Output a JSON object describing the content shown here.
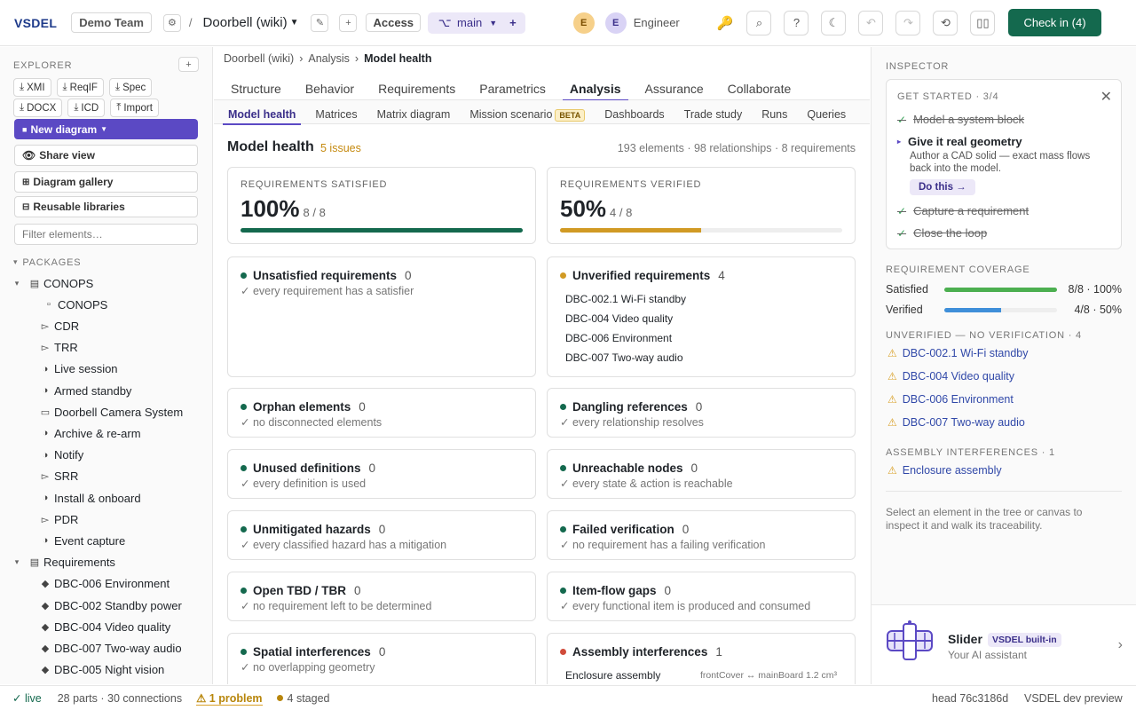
{
  "header": {
    "logo": "VSDEL",
    "team": "Demo Team",
    "sep": "/",
    "project": "Doorbell (wiki)",
    "access": "Access",
    "branch": "main",
    "avatar1": "E",
    "avatar2": "E",
    "user": "Engineer",
    "checkin": "Check in (4)"
  },
  "explorer": {
    "title": "EXPLORER",
    "add": "+",
    "exports": [
      "XMI",
      "ReqIF",
      "Spec",
      "DOCX",
      "ICD",
      "Import"
    ],
    "new_diagram": "New diagram",
    "share_view": "Share view",
    "gallery": "Diagram gallery",
    "libraries": "Reusable libraries",
    "filter_placeholder": "Filter elements…",
    "packages_title": "PACKAGES",
    "tree": [
      {
        "label": "CONOPS",
        "icon": "▤",
        "depth": 0,
        "caret": "▾"
      },
      {
        "label": "CONOPS",
        "icon": "▫",
        "depth": 2
      },
      {
        "label": "CDR",
        "icon": "▻",
        "depth": 1
      },
      {
        "label": "TRR",
        "icon": "▻",
        "depth": 1
      },
      {
        "label": "Live session",
        "icon": "◑",
        "depth": 1
      },
      {
        "label": "Armed standby",
        "icon": "◑",
        "depth": 1
      },
      {
        "label": "Doorbell Camera System",
        "icon": "▭",
        "depth": 1
      },
      {
        "label": "Archive & re-arm",
        "icon": "◑",
        "depth": 1
      },
      {
        "label": "Notify",
        "icon": "◑",
        "depth": 1
      },
      {
        "label": "SRR",
        "icon": "▻",
        "depth": 1
      },
      {
        "label": "Install & onboard",
        "icon": "◑",
        "depth": 1
      },
      {
        "label": "PDR",
        "icon": "▻",
        "depth": 1
      },
      {
        "label": "Event capture",
        "icon": "◑",
        "depth": 1
      },
      {
        "label": "Requirements",
        "icon": "▤",
        "depth": 0,
        "caret": "▾"
      },
      {
        "label": "DBC-006 Environment",
        "icon": "◆",
        "depth": 1
      },
      {
        "label": "DBC-002 Standby power",
        "icon": "◆",
        "depth": 1
      },
      {
        "label": "DBC-004 Video quality",
        "icon": "◆",
        "depth": 1
      },
      {
        "label": "DBC-007 Two-way audio",
        "icon": "◆",
        "depth": 1
      },
      {
        "label": "DBC-005 Night vision",
        "icon": "◆",
        "depth": 1
      }
    ]
  },
  "breadcrumb": [
    "Doorbell (wiki)",
    "Analysis",
    "Model health"
  ],
  "tabs": [
    "Structure",
    "Behavior",
    "Requirements",
    "Parametrics",
    "Analysis",
    "Assurance",
    "Collaborate"
  ],
  "subtabs": [
    "Model health",
    "Matrices",
    "Matrix diagram",
    "Mission scenario",
    "Dashboards",
    "Trade study",
    "Runs",
    "Queries"
  ],
  "beta": "BETA",
  "health": {
    "title": "Model health",
    "issues": "5 issues",
    "summary": "193 elements · 98 relationships · 8 requirements",
    "req_satisfied": {
      "label": "REQUIREMENTS SATISFIED",
      "value": "100%",
      "frac": "8 / 8",
      "fill": 1.0,
      "color": "#14694e"
    },
    "req_verified": {
      "label": "REQUIREMENTS VERIFIED",
      "value": "50%",
      "frac": "4 / 8",
      "fill": 0.5,
      "color": "#d19a24"
    },
    "cards": [
      {
        "title": "Unsatisfied requirements",
        "count": "0",
        "sub": "✓ every requirement has a satisfier",
        "dot": "#14694e"
      },
      {
        "title": "Unverified requirements",
        "count": "4",
        "items": [
          "DBC-002.1 Wi-Fi standby",
          "DBC-004 Video quality",
          "DBC-006 Environment",
          "DBC-007 Two-way audio"
        ],
        "dot": "#d19a24"
      },
      {
        "title": "Orphan elements",
        "count": "0",
        "sub": "✓ no disconnected elements",
        "dot": "#14694e"
      },
      {
        "title": "Dangling references",
        "count": "0",
        "sub": "✓ every relationship resolves",
        "dot": "#14694e"
      },
      {
        "title": "Unused definitions",
        "count": "0",
        "sub": "✓ every definition is used",
        "dot": "#14694e"
      },
      {
        "title": "Unreachable nodes",
        "count": "0",
        "sub": "✓ every state & action is reachable",
        "dot": "#14694e"
      },
      {
        "title": "Unmitigated hazards",
        "count": "0",
        "sub": "✓ every classified hazard has a mitigation",
        "dot": "#14694e"
      },
      {
        "title": "Failed verification",
        "count": "0",
        "sub": "✓ no requirement has a failing verification",
        "dot": "#14694e"
      },
      {
        "title": "Open TBD / TBR",
        "count": "0",
        "sub": "✓ no requirement left to be determined",
        "dot": "#14694e"
      },
      {
        "title": "Item-flow gaps",
        "count": "0",
        "sub": "✓ every functional item is produced and consumed",
        "dot": "#14694e"
      },
      {
        "title": "Spatial interferences",
        "count": "0",
        "sub": "✓ no overlapping geometry",
        "dot": "#14694e"
      },
      {
        "title": "Assembly interferences",
        "count": "1",
        "item": "Enclosure assembly",
        "detail": "frontCover ↔ mainBoard 1.2 cm³",
        "dot": "#d04b3a"
      }
    ]
  },
  "inspector": {
    "title": "INSPECTOR",
    "get_started": "GET STARTED · 3/4",
    "steps": [
      {
        "label": "Model a system block",
        "done": true
      },
      {
        "label": "Give it real geometry",
        "done": false,
        "desc": "Author a CAD solid — exact mass flows back into the model.",
        "action": "Do this →"
      },
      {
        "label": "Capture a requirement",
        "done": true
      },
      {
        "label": "Close the loop",
        "done": true
      }
    ],
    "coverage_title": "REQUIREMENT COVERAGE",
    "coverage": [
      {
        "label": "Satisfied",
        "value": "8/8 · 100%",
        "fill": 1.0,
        "color": "#4caf50"
      },
      {
        "label": "Verified",
        "value": "4/8 · 50%",
        "fill": 0.5,
        "color": "#3f8fd9"
      }
    ],
    "unverified_title": "UNVERIFIED — NO VERIFICATION · 4",
    "unverified": [
      "DBC-002.1 Wi-Fi standby",
      "DBC-004 Video quality",
      "DBC-006 Environment",
      "DBC-007 Two-way audio"
    ],
    "interf_title": "ASSEMBLY INTERFERENCES · 1",
    "interf": [
      "Enclosure assembly"
    ],
    "hint": "Select an element in the tree or canvas to inspect it and walk its traceability.",
    "assistant_name": "Slider",
    "assistant_badge": "VSDEL built-in",
    "assistant_sub": "Your AI assistant"
  },
  "status": {
    "live": "live",
    "counts": "28 parts · 30 connections",
    "problem": "1 problem",
    "staged": "4 staged",
    "head": "head 76c3186d",
    "env": "VSDEL dev preview"
  }
}
